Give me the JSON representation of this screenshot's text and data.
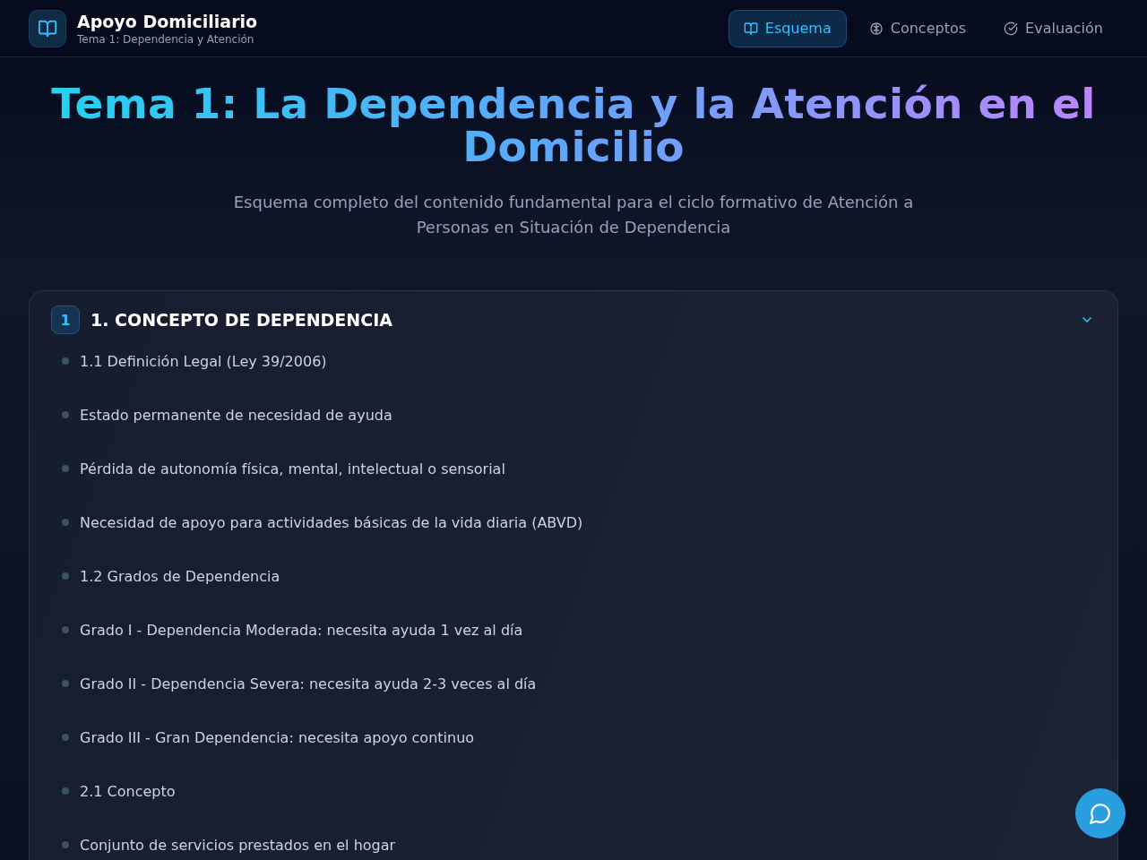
{
  "app": {
    "title": "Apoyo Domiciliario",
    "subtitle": "Tema 1: Dependencia y Atención"
  },
  "nav": [
    {
      "label": "Esquema",
      "kind": "book",
      "selected": true
    },
    {
      "label": "Conceptos",
      "kind": "brain",
      "selected": false
    },
    {
      "label": "Evaluación",
      "kind": "check",
      "selected": false
    }
  ],
  "hero": {
    "title": "Tema 1: La Dependencia y la Atención en el Domicilio",
    "description": "Esquema completo del contenido fundamental para el ciclo formativo de Atención a Personas en Situación de Dependencia"
  },
  "sections": [
    {
      "number": "1",
      "title": "1. CONCEPTO DE DEPENDENCIA",
      "expanded": true,
      "items": [
        "1.1 Definición Legal (Ley 39/2006)",
        "Estado permanente de necesidad de ayuda",
        "Pérdida de autonomía física, mental, intelectual o sensorial",
        "Necesidad de apoyo para actividades básicas de la vida diaria (ABVD)",
        "1.2 Grados de Dependencia",
        "Grado I - Dependencia Moderada: necesita ayuda 1 vez al día",
        "Grado II - Dependencia Severa: necesita ayuda 2-3 veces al día",
        "Grado III - Gran Dependencia: necesita apoyo continuo",
        "2.1 Concepto",
        "Conjunto de servicios prestados en el hogar"
      ]
    }
  ]
}
